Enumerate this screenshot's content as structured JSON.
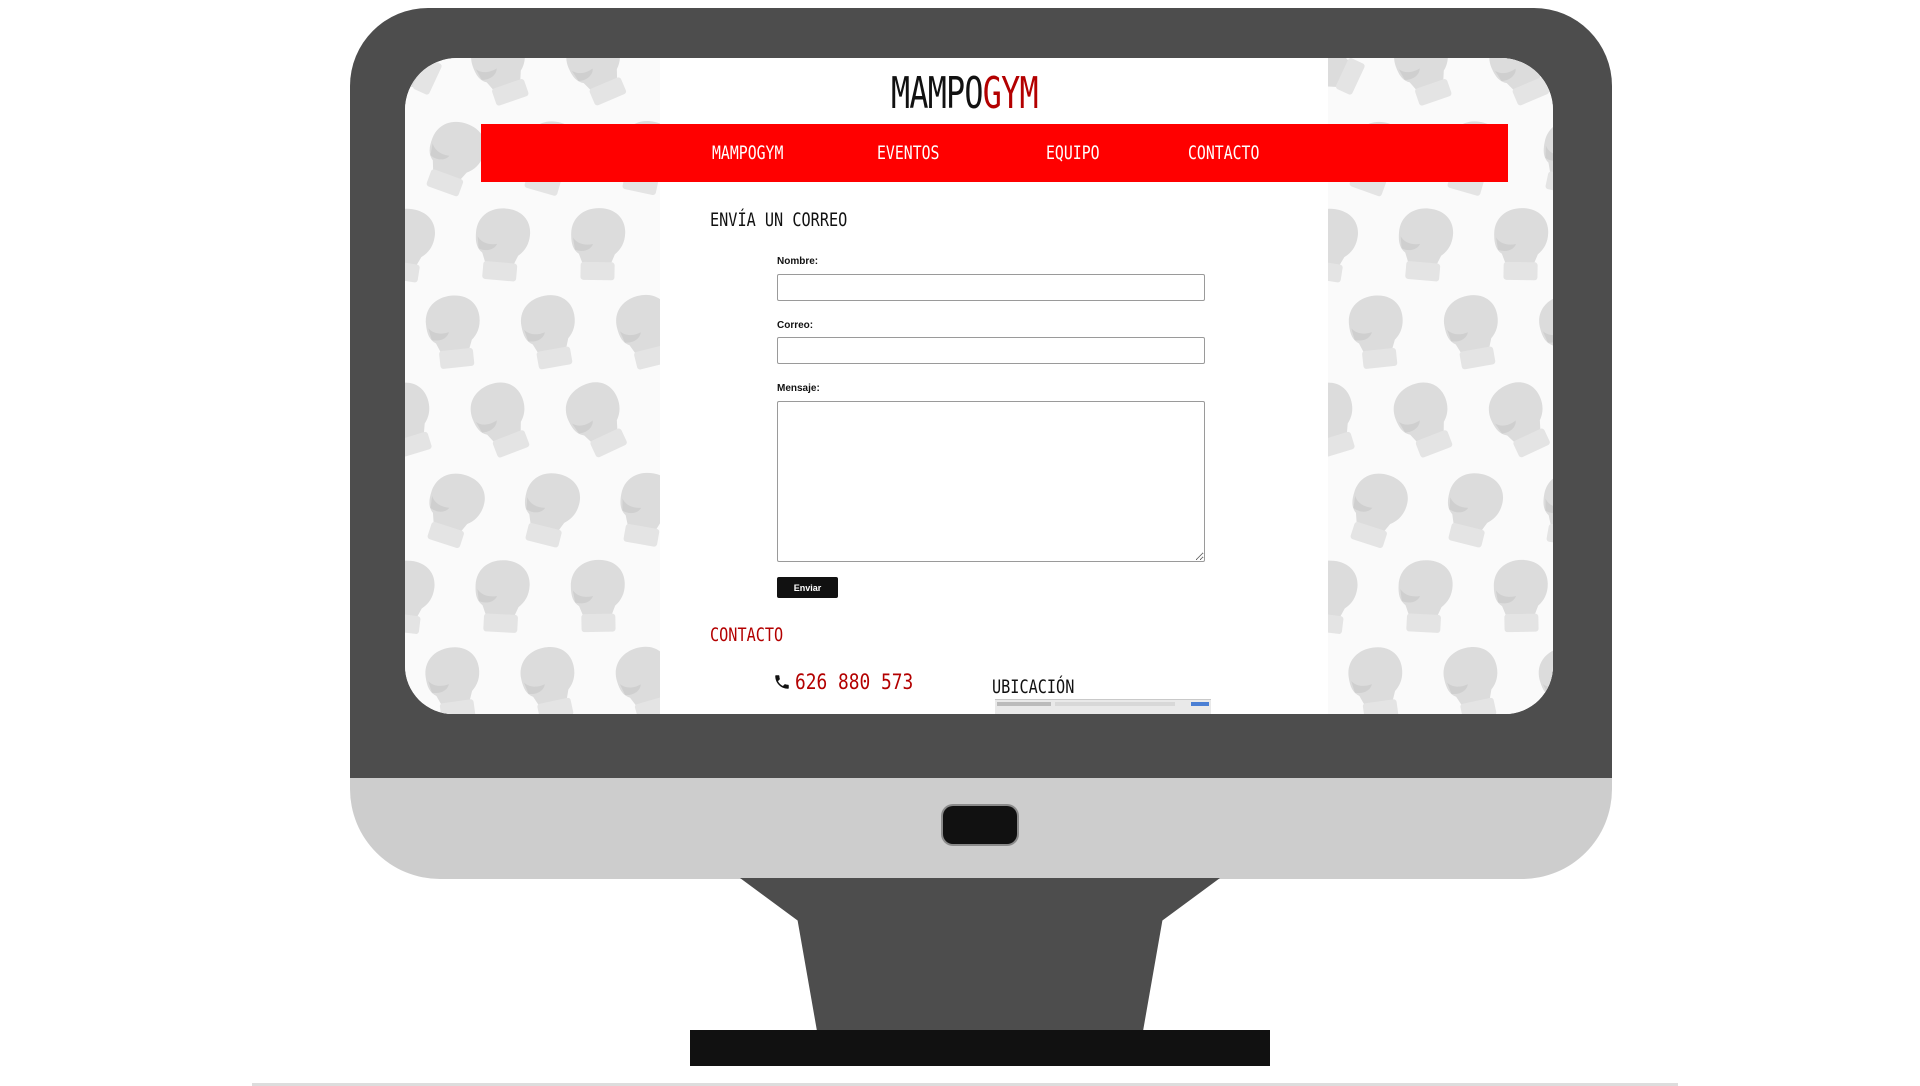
{
  "site": {
    "brand_part1": "MAMPO",
    "brand_part2": "GYM",
    "nav": [
      {
        "label": "MAMPOGYM"
      },
      {
        "label": "EVENTOS"
      },
      {
        "label": "EQUIPO"
      },
      {
        "label": "CONTACTO"
      }
    ]
  },
  "form": {
    "title": "ENVÍA UN CORREO",
    "name_label": "Nombre:",
    "name_value": "",
    "email_label": "Correo:",
    "email_value": "",
    "message_label": "Mensaje:",
    "message_value": "",
    "submit_label": "Enviar"
  },
  "contact": {
    "title": "CONTACTO",
    "phone": "626 880 573",
    "location_title": "UBICACIÓN"
  },
  "colors": {
    "nav_bg": "#ff0000",
    "accent_red": "#b30000",
    "monitor_frame": "#4d4d4d",
    "monitor_chin": "#cdcdcd"
  },
  "icons": [
    "phone-icon",
    "boxing-glove-icon"
  ]
}
